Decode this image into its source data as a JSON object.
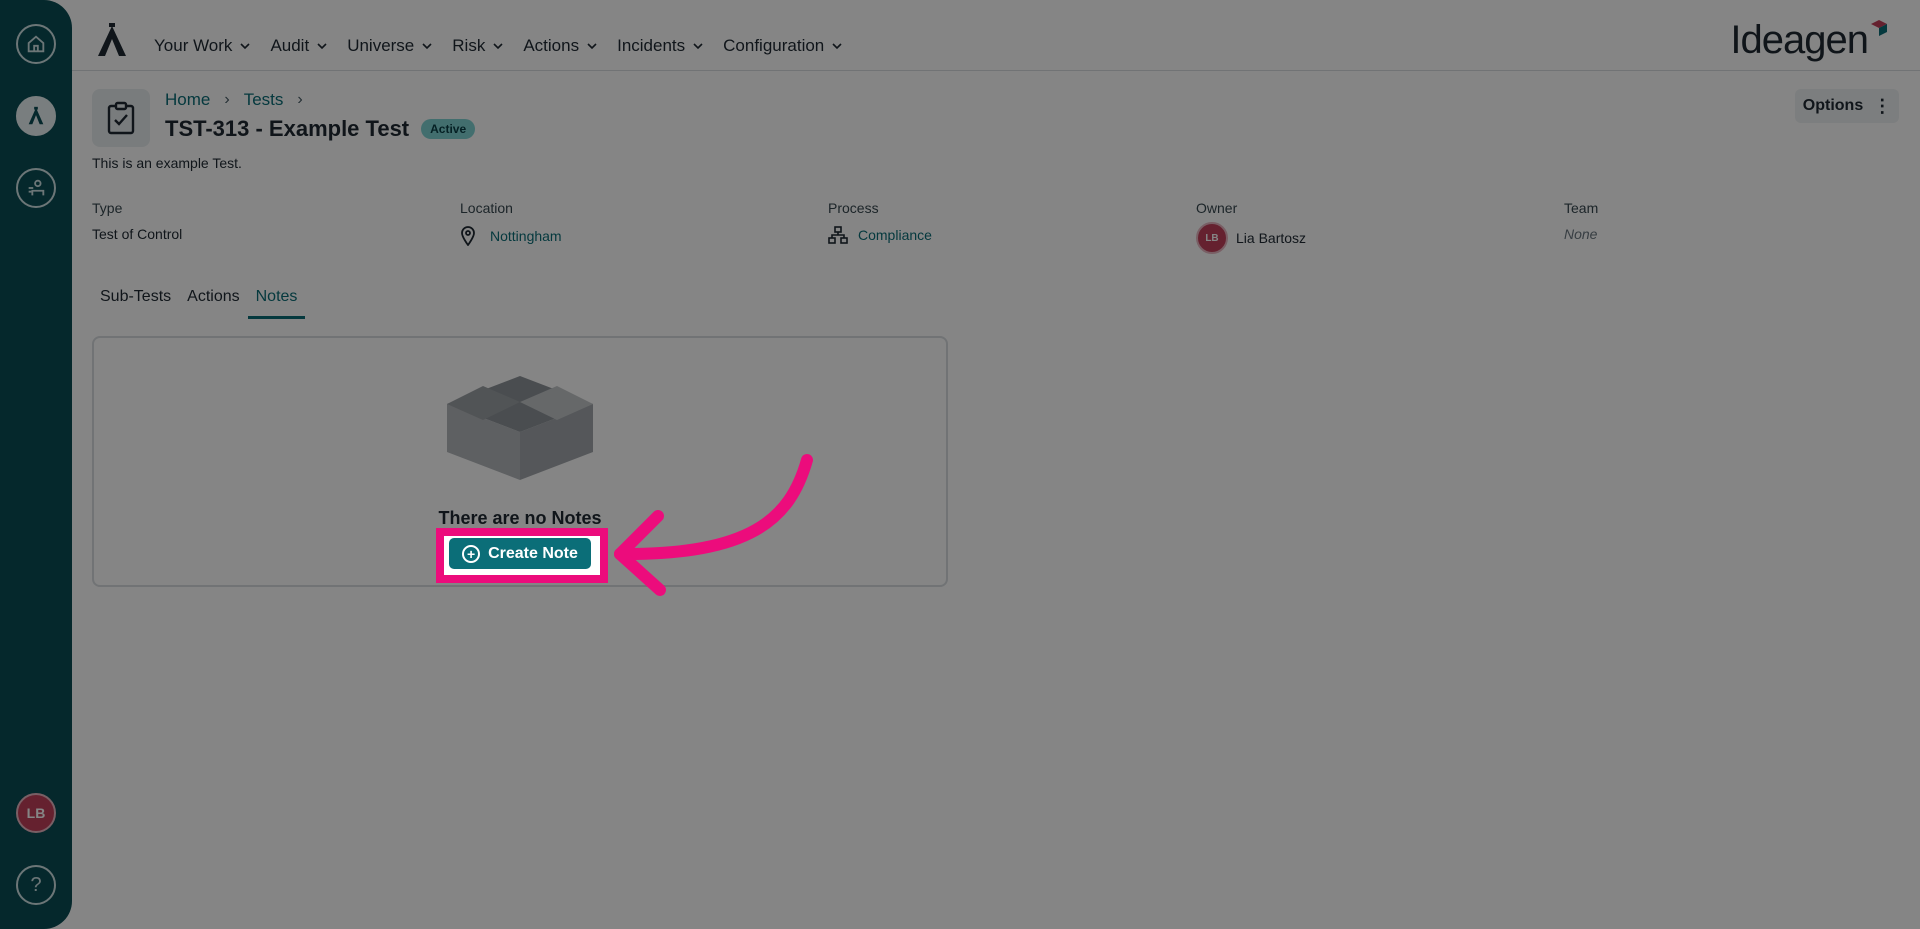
{
  "nav": {
    "items": [
      "Your Work",
      "Audit",
      "Universe",
      "Risk",
      "Actions",
      "Incidents",
      "Configuration"
    ],
    "brand": "Ideagen"
  },
  "rail": {
    "user_initials": "LB",
    "help_label": "?"
  },
  "page": {
    "breadcrumb": [
      "Home",
      "Tests"
    ],
    "title": "TST-313 - Example Test",
    "status": "Active",
    "description": "This is an example Test.",
    "options_label": "Options"
  },
  "properties": {
    "type": {
      "label": "Type",
      "value": "Test of Control"
    },
    "location": {
      "label": "Location",
      "value": "Nottingham"
    },
    "process": {
      "label": "Process",
      "value": "Compliance"
    },
    "owner": {
      "label": "Owner",
      "value": "Lia Bartosz",
      "initials": "LB"
    },
    "team": {
      "label": "Team",
      "value": "None"
    }
  },
  "tabs": [
    "Sub-Tests",
    "Actions",
    "Notes"
  ],
  "notes": {
    "empty_text": "There are no Notes",
    "create_label": "Create Note"
  },
  "colors": {
    "rail": "#0b4d55",
    "accent": "#0b6e78",
    "highlight": "#ec0c7c",
    "badge": "#7fd3d3",
    "avatar": "#c2405a"
  }
}
